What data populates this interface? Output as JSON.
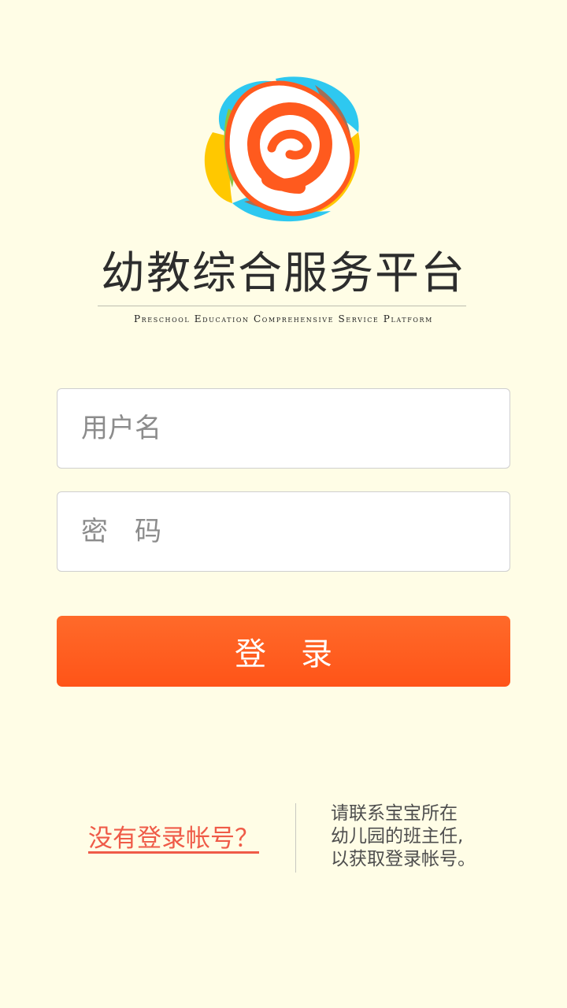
{
  "app": {
    "title": "幼教综合服务平台",
    "subtitle": "Preschool Education Comprehensive Service Platform"
  },
  "login_form": {
    "username_placeholder": "用户名",
    "password_placeholder": "密　码",
    "login_label": "登录"
  },
  "footer": {
    "no_account_link": "没有登录帐号？",
    "help_lines": [
      "请联系宝宝所在",
      "幼儿园的班主任,",
      "以获取登录帐号。"
    ]
  },
  "colors": {
    "background": "#fffde6",
    "accent": "#ff5a1e",
    "link": "#ef5b48"
  },
  "icons": {
    "logo": "colorful-flower-e-logo-icon"
  }
}
